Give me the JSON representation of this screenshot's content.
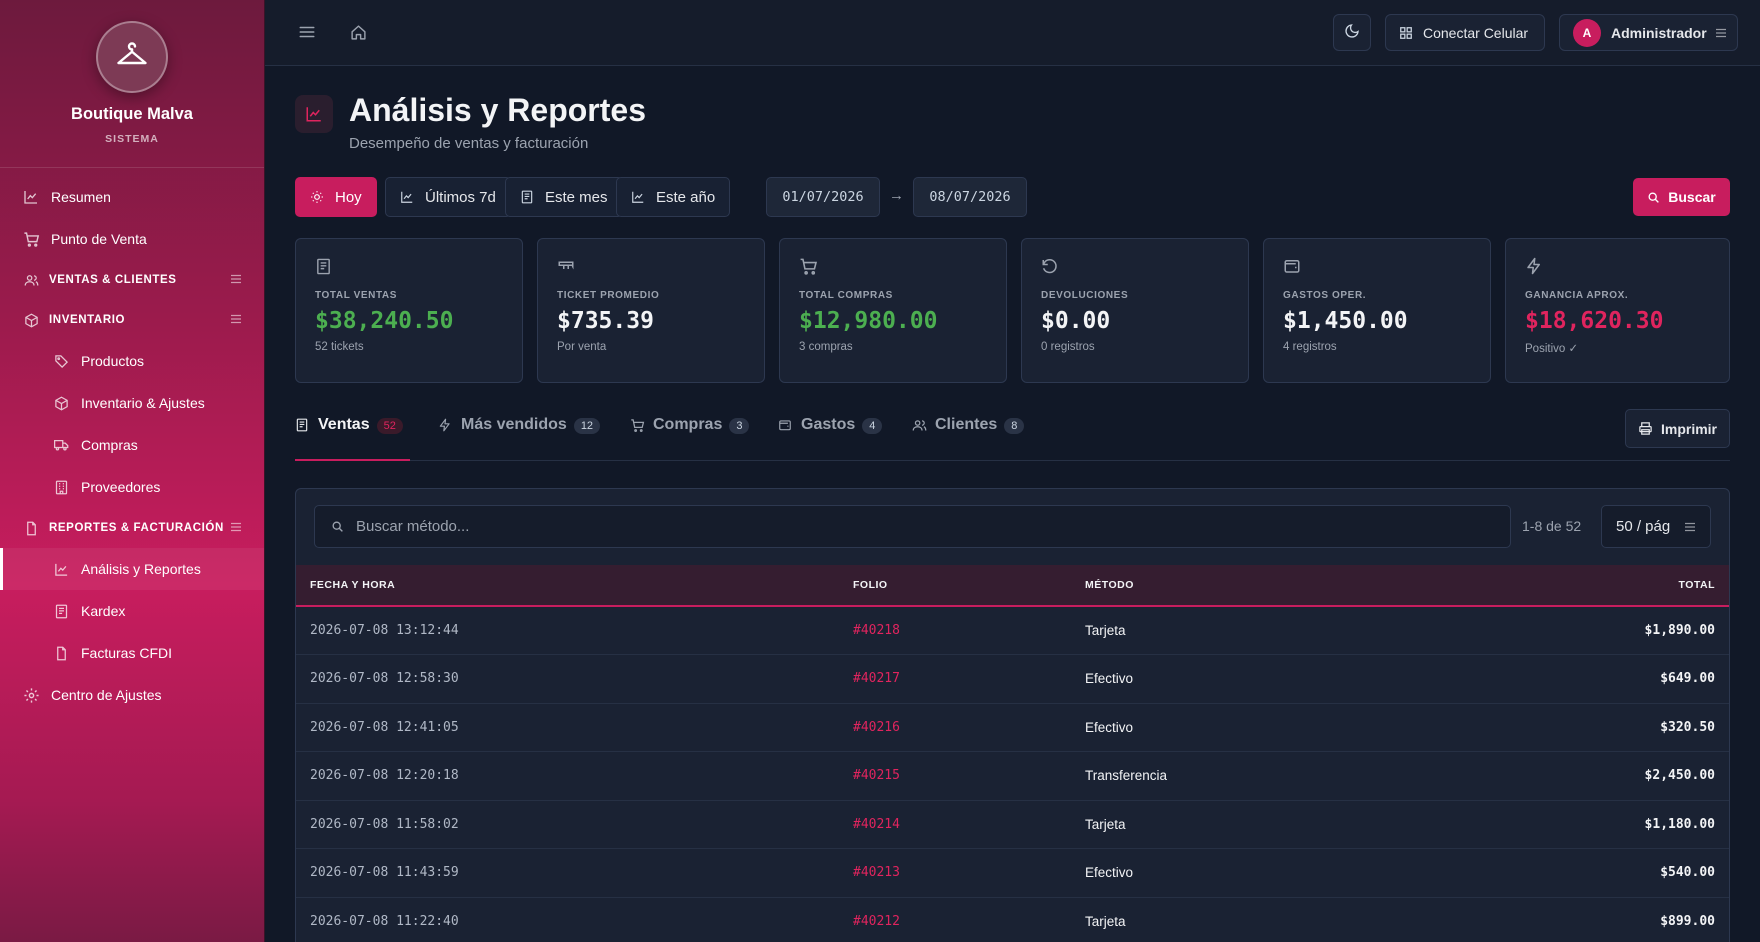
{
  "brand": {
    "name": "Boutique Malva",
    "subtitle": "SISTEMA"
  },
  "sidebar": {
    "items": [
      {
        "label": "Resumen",
        "icon": "chart-line-icon"
      },
      {
        "label": "Punto de Venta",
        "icon": "cart-icon"
      },
      {
        "label": "VENTAS & CLIENTES",
        "icon": "users-icon",
        "section": true
      },
      {
        "label": "INVENTARIO",
        "icon": "box-icon",
        "section": true
      },
      {
        "label": "Productos",
        "icon": "tag-icon"
      },
      {
        "label": "Inventario & Ajustes",
        "icon": "box-icon"
      },
      {
        "label": "Compras",
        "icon": "truck-icon"
      },
      {
        "label": "Proveedores",
        "icon": "building-icon"
      },
      {
        "label": "REPORTES & FACTURACIÓN",
        "icon": "file-icon",
        "section": true
      },
      {
        "label": "Análisis y Reportes",
        "icon": "chart-line-icon",
        "active": true
      },
      {
        "label": "Kardex",
        "icon": "receipt-icon"
      },
      {
        "label": "Facturas CFDI",
        "icon": "file-icon"
      },
      {
        "label": "Centro de Ajustes",
        "icon": "gear-icon"
      }
    ]
  },
  "topbar": {
    "connect_label": "Conectar Celular",
    "user_initial": "A",
    "user_name": "Administrador"
  },
  "page": {
    "title": "Análisis y Reportes",
    "subtitle": "Desempeño de ventas y facturación"
  },
  "filters": {
    "today": "Hoy",
    "last7": "Últimos 7d",
    "this_month": "Este mes",
    "this_year": "Este año",
    "date_from": "01/07/2026",
    "arrow": "→",
    "date_to": "08/07/2026",
    "search": "Buscar"
  },
  "cards": [
    {
      "label": "TOTAL VENTAS",
      "value": "$38,240.50",
      "sub": "52 tickets",
      "icon": "receipt-icon",
      "color": "#4caf50"
    },
    {
      "label": "TICKET PROMEDIO",
      "value": "$735.39",
      "sub": "Por venta",
      "icon": "ticket-icon",
      "color": "#f3f4f6"
    },
    {
      "label": "TOTAL COMPRAS",
      "value": "$12,980.00",
      "sub": "3 compras",
      "icon": "cart-icon",
      "color": "#4caf50"
    },
    {
      "label": "DEVOLUCIONES",
      "value": "$0.00",
      "sub": "0 registros",
      "icon": "undo-icon",
      "color": "#f3f4f6"
    },
    {
      "label": "GASTOS OPER.",
      "value": "$1,450.00",
      "sub": "4 registros",
      "icon": "wallet-icon",
      "color": "#f3f4f6"
    },
    {
      "label": "GANANCIA APROX.",
      "value": "$18,620.30",
      "sub": "Positivo ✓",
      "icon": "bolt-icon",
      "color": "#e0245e"
    }
  ],
  "tabs": [
    {
      "label": "Ventas",
      "count": "52",
      "icon": "receipt-icon"
    },
    {
      "label": "Más vendidos",
      "count": "12",
      "icon": "bolt-icon"
    },
    {
      "label": "Compras",
      "count": "3",
      "icon": "cart-icon"
    },
    {
      "label": "Gastos",
      "count": "4",
      "icon": "wallet-icon"
    },
    {
      "label": "Clientes",
      "count": "8",
      "icon": "users-icon"
    }
  ],
  "print_label": "Imprimir",
  "table": {
    "search_placeholder": "Buscar método...",
    "page_info": "1-8 de 52",
    "per_page": "50 / pág",
    "headers": [
      "FECHA Y HORA",
      "FOLIO",
      "MÉTODO",
      "TOTAL"
    ],
    "rows": [
      [
        "2026-07-08 13:12:44",
        "#40218",
        "Tarjeta",
        "$1,890.00"
      ],
      [
        "2026-07-08 12:58:30",
        "#40217",
        "Efectivo",
        "$649.00"
      ],
      [
        "2026-07-08 12:41:05",
        "#40216",
        "Efectivo",
        "$320.50"
      ],
      [
        "2026-07-08 12:20:18",
        "#40215",
        "Transferencia",
        "$2,450.00"
      ],
      [
        "2026-07-08 11:58:02",
        "#40214",
        "Tarjeta",
        "$1,180.00"
      ],
      [
        "2026-07-08 11:43:59",
        "#40213",
        "Efectivo",
        "$540.00"
      ],
      [
        "2026-07-08 11:22:40",
        "#40212",
        "Tarjeta",
        "$899.00"
      ]
    ]
  },
  "colors": {
    "accent": "#c81d5e",
    "positive": "#4caf50",
    "bg": "#111827"
  }
}
